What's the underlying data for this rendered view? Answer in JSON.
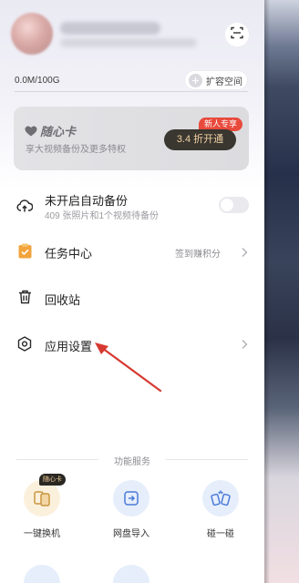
{
  "profile": {
    "scan_icon": "scan-icon"
  },
  "storage": {
    "usage_text": "0.0M/100G",
    "expand_label": "扩容空间"
  },
  "member_card": {
    "title": "随心卡",
    "subtitle": "享大视频备份及更多特权",
    "badge": "新人专享",
    "button": "3.4 折开通"
  },
  "menu": {
    "backup": {
      "title": "未开启自动备份",
      "subtitle": "409 张照片和1个视频待备份",
      "toggle_on": false
    },
    "tasks": {
      "title": "任务中心",
      "right_text": "签到赚积分"
    },
    "recycle": {
      "title": "回收站"
    },
    "settings": {
      "title": "应用设置"
    }
  },
  "services": {
    "section_label": "功能服务",
    "items": [
      {
        "label": "一键换机",
        "tag": "随心卡",
        "icon": "phone-switch-icon"
      },
      {
        "label": "网盘导入",
        "icon": "cloud-import-icon"
      },
      {
        "label": "碰一碰",
        "icon": "bump-share-icon"
      }
    ]
  },
  "colors": {
    "accent_red": "#e84a3c",
    "annotation_arrow": "#d63a32",
    "card_button_bg": "#3a3630",
    "card_button_text": "#f1d3a3"
  }
}
